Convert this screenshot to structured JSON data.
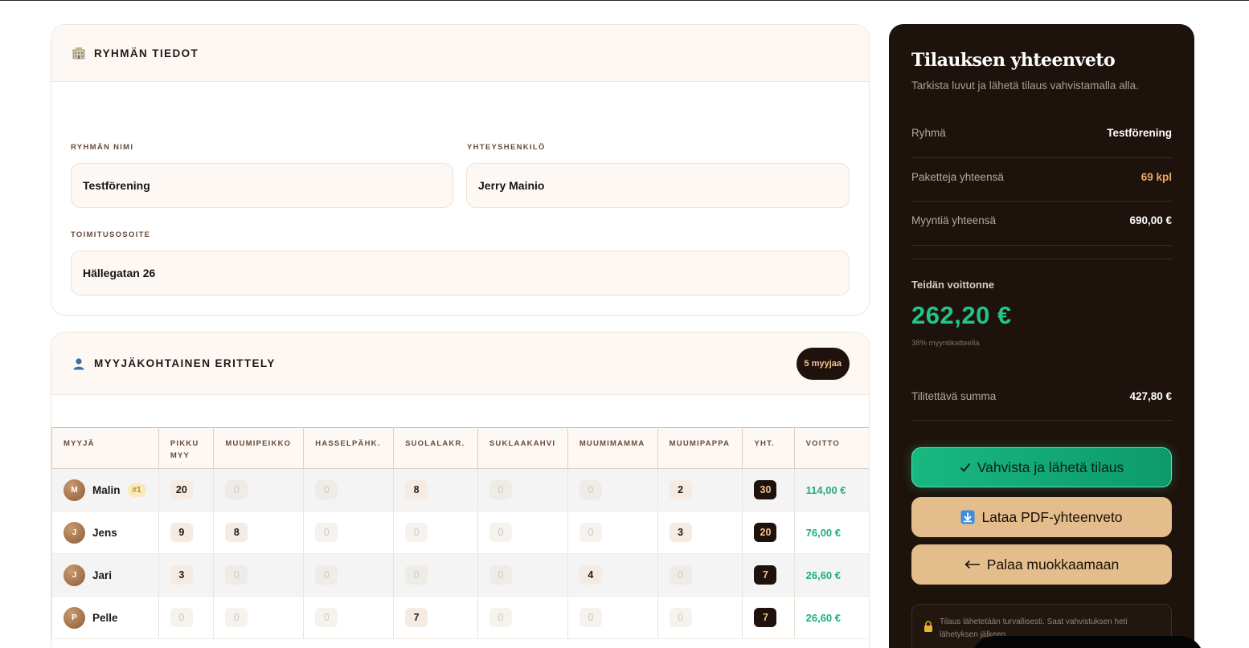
{
  "group_card": {
    "title": "RYHMÄN TIEDOT",
    "group_name_label": "RYHMÄN NIMI",
    "group_name_value": "Testförening",
    "contact_label": "YHTEYSHENKILÖ",
    "contact_value": "Jerry Mainio",
    "address_label": "TOIMITUSOSOITE",
    "address_value": "Hällegatan 26"
  },
  "sellers_card": {
    "title": "MYYJÄKOHTAINEN ERITTELY",
    "count_badge": "5 myyjaa",
    "columns": [
      "MYYJÄ",
      "PIKKU MYY",
      "MUUMIPEIKKO",
      "HASSELPÄHK.",
      "SUOLALAKR.",
      "SUKLAAKAHVI",
      "MUUMIMAMMA",
      "MUUMIPAPPA",
      "YHT.",
      "VOITTO"
    ],
    "rows": [
      {
        "initial": "M",
        "name": "Malin",
        "rank": "#1",
        "q": [
          "20",
          "0",
          "0",
          "8",
          "0",
          "0",
          "2"
        ],
        "total": "30",
        "profit": "114,00 €"
      },
      {
        "initial": "J",
        "name": "Jens",
        "rank": "",
        "q": [
          "9",
          "8",
          "0",
          "0",
          "0",
          "0",
          "3"
        ],
        "total": "20",
        "profit": "76,00 €"
      },
      {
        "initial": "J",
        "name": "Jari",
        "rank": "",
        "q": [
          "3",
          "0",
          "0",
          "0",
          "0",
          "4",
          "0"
        ],
        "total": "7",
        "profit": "26,60 €"
      },
      {
        "initial": "P",
        "name": "Pelle",
        "rank": "",
        "q": [
          "0",
          "0",
          "0",
          "7",
          "0",
          "0",
          "0"
        ],
        "total": "7",
        "profit": "26,60 €"
      }
    ]
  },
  "summary": {
    "title": "Tilauksen yhteenveto",
    "subtitle": "Tarkista luvut ja lähetä tilaus vahvistamalla alla.",
    "group_label": "Ryhmä",
    "group_value": "Testförening",
    "packages_label": "Paketteja yhteensä",
    "packages_value": "69 kpl",
    "sales_label": "Myyntiä yhteensä",
    "sales_value": "690,00 €",
    "profit_label": "Teidän voittonne",
    "profit_value": "262,20 €",
    "profit_note": "38% myyntikatteella",
    "payable_label": "Tilitettävä summa",
    "payable_value": "427,80 €",
    "confirm_button": "Vahvista ja lähetä tilaus",
    "pdf_button": "Lataa PDF-yhteenveto",
    "back_button": "Palaa muokkaamaan",
    "secure_note": "Tilaus lähetetään turvallisesti. Saat vahvistuksen heti lähetyksen jälkeen.",
    "colors": {
      "panel": "#1e120c",
      "accent_green": "#21c58a",
      "accent_orange": "#f0a866",
      "button_tan": "#e4bd8d"
    }
  }
}
